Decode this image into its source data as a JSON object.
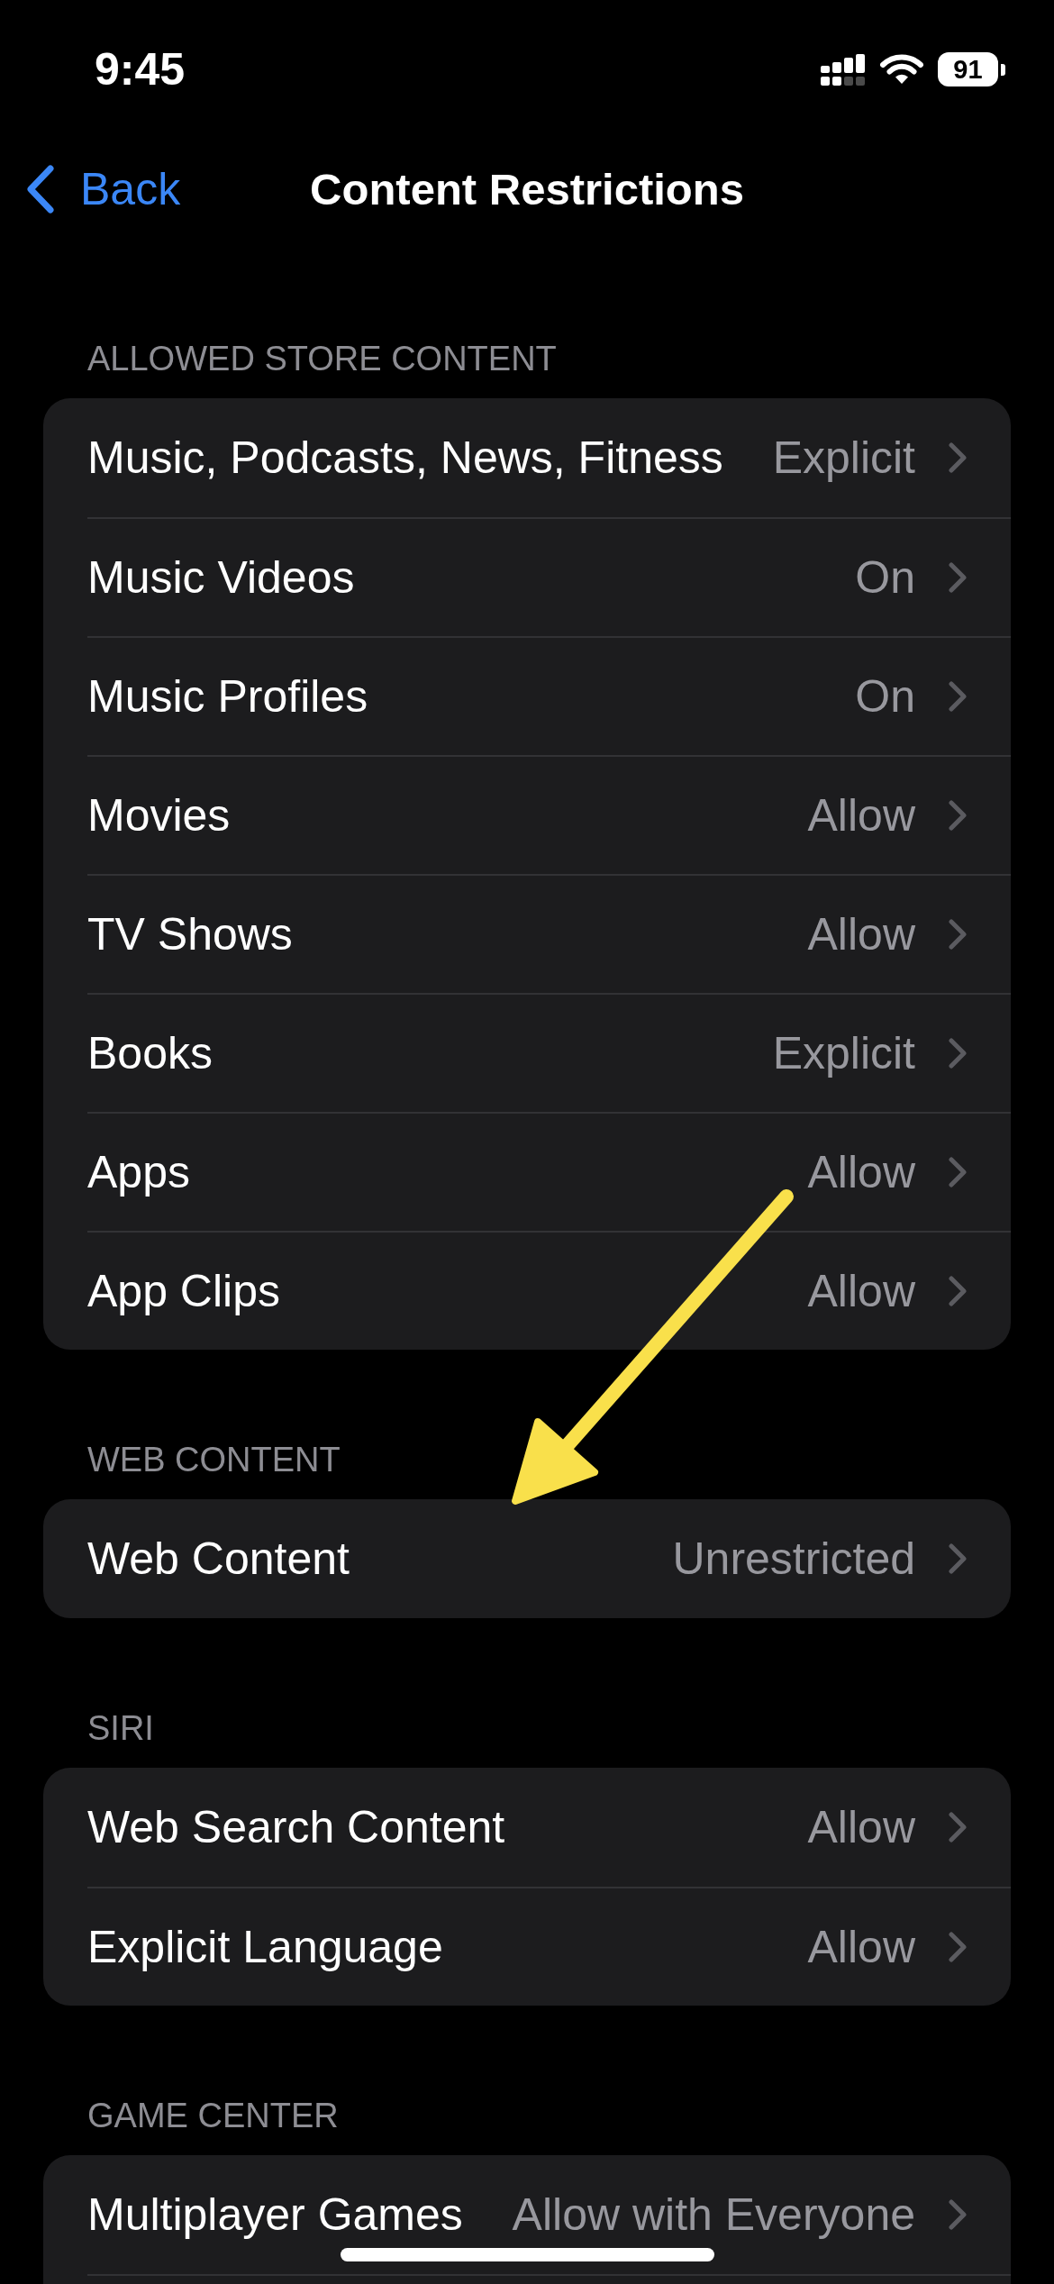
{
  "status_bar": {
    "time": "9:45",
    "battery": "91"
  },
  "nav_bar": {
    "back_label": "Back",
    "title": "Content Restrictions"
  },
  "sections": [
    {
      "header": "ALLOWED STORE CONTENT",
      "continues_below": false,
      "rows": [
        {
          "label": "Music, Podcasts, News, Fitness",
          "value": "Explicit"
        },
        {
          "label": "Music Videos",
          "value": "On"
        },
        {
          "label": "Music Profiles",
          "value": "On"
        },
        {
          "label": "Movies",
          "value": "Allow"
        },
        {
          "label": "TV Shows",
          "value": "Allow"
        },
        {
          "label": "Books",
          "value": "Explicit"
        },
        {
          "label": "Apps",
          "value": "Allow"
        },
        {
          "label": "App Clips",
          "value": "Allow"
        }
      ]
    },
    {
      "header": "WEB CONTENT",
      "continues_below": false,
      "rows": [
        {
          "label": "Web Content",
          "value": "Unrestricted"
        }
      ]
    },
    {
      "header": "SIRI",
      "continues_below": false,
      "rows": [
        {
          "label": "Web Search Content",
          "value": "Allow"
        },
        {
          "label": "Explicit Language",
          "value": "Allow"
        }
      ]
    },
    {
      "header": "GAME CENTER",
      "continues_below": true,
      "rows": [
        {
          "label": "Multiplayer Games",
          "value": "Allow with Everyone"
        }
      ]
    }
  ],
  "annotations": [
    {
      "kind": "arrow"
    }
  ]
}
